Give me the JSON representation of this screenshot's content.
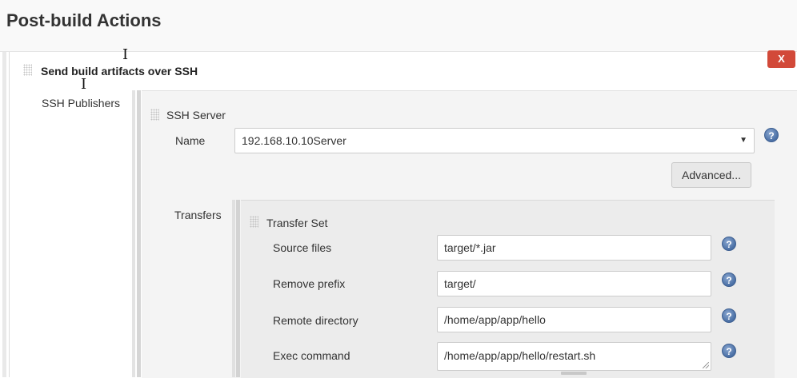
{
  "section": {
    "title": "Post-build Actions"
  },
  "action": {
    "title": "Send build artifacts over SSH",
    "delete_label": "X"
  },
  "publishers": {
    "label": "SSH Publishers",
    "server": {
      "title": "SSH Server",
      "name_label": "Name",
      "name_value": "192.168.10.10Server",
      "advanced_label": "Advanced...",
      "transfers_label": "Transfers",
      "transfer_set": {
        "title": "Transfer Set",
        "source_files_label": "Source files",
        "source_files_value": "target/*.jar",
        "remove_prefix_label": "Remove prefix",
        "remove_prefix_value": "target/",
        "remote_directory_label": "Remote directory",
        "remote_directory_value": "/home/app/app/hello",
        "exec_command_label": "Exec command",
        "exec_command_value": "/home/app/app/hello/restart.sh"
      }
    }
  },
  "icons": {
    "help": "?",
    "dropdown": "▼"
  },
  "colors": {
    "delete_button": "#d24939",
    "help_icon": "#4a6fa5"
  }
}
